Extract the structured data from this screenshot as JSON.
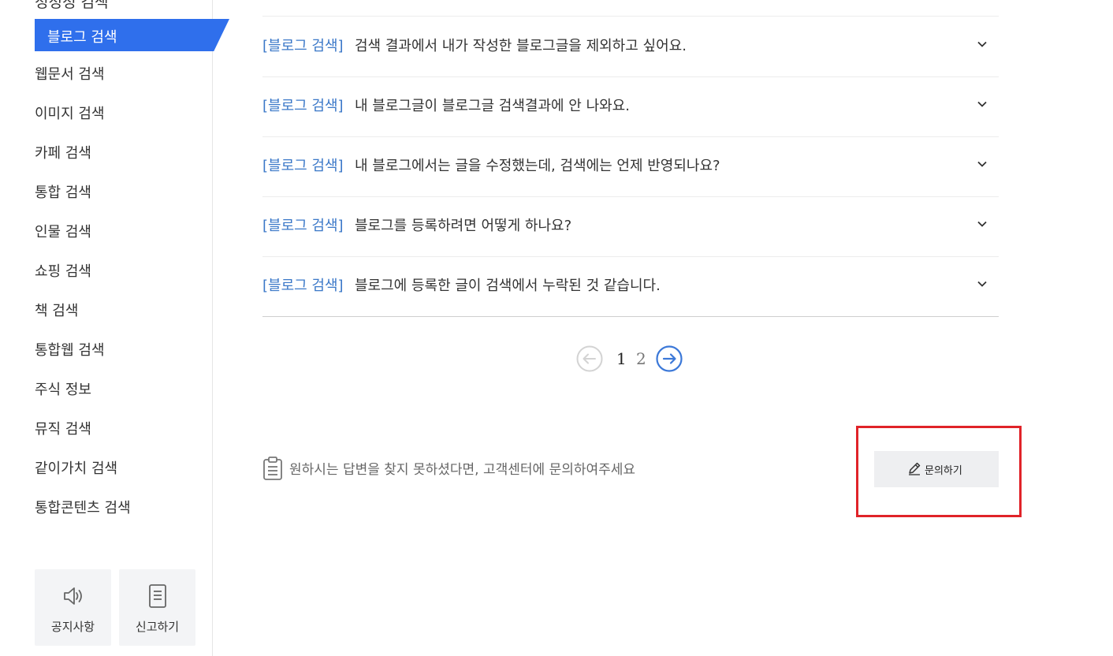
{
  "sidebar": {
    "cut_item": "정정정 검색",
    "active_item": "블로그 검색",
    "items": [
      "웹문서 검색",
      "이미지 검색",
      "카페 검색",
      "통합 검색",
      "인물 검색",
      "쇼핑 검색",
      "책 검색",
      "통합웹 검색",
      "주식 정보",
      "뮤직 검색",
      "같이가치 검색",
      "통합콘텐츠 검색"
    ],
    "quick": [
      {
        "label": "공지사항",
        "icon": "speaker-icon"
      },
      {
        "label": "신고하기",
        "icon": "document-icon"
      }
    ],
    "active_color": "#2f6fec"
  },
  "faq": [
    {
      "category": "[블로그 검색]",
      "question": "검색 결과에서 내가 작성한 블로그글을 제외하고 싶어요."
    },
    {
      "category": "[블로그 검색]",
      "question": "내 블로그글이 블로그글 검색결과에 안 나와요."
    },
    {
      "category": "[블로그 검색]",
      "question": "내 블로그에서는 글을 수정했는데, 검색에는 언제 반영되나요?"
    },
    {
      "category": "[블로그 검색]",
      "question": "블로그를 등록하려면 어떻게 하나요?"
    },
    {
      "category": "[블로그 검색]",
      "question": "블로그에 등록한 글이 검색에서 누락된 것 같습니다."
    }
  ],
  "pagination": {
    "current": "1",
    "next": "2",
    "prev_icon": "arrow-left-circle-icon",
    "next_icon": "arrow-right-circle-icon",
    "active_color": "#3b78d8"
  },
  "help": {
    "text": "원하시는 답변을 찾지 못하셨다면, 고객센터에 문의하여주세요",
    "icon": "clipboard-icon"
  },
  "inquiry_button": {
    "label": "문의하기",
    "icon": "pencil-icon"
  },
  "highlight_color": "#e02329"
}
